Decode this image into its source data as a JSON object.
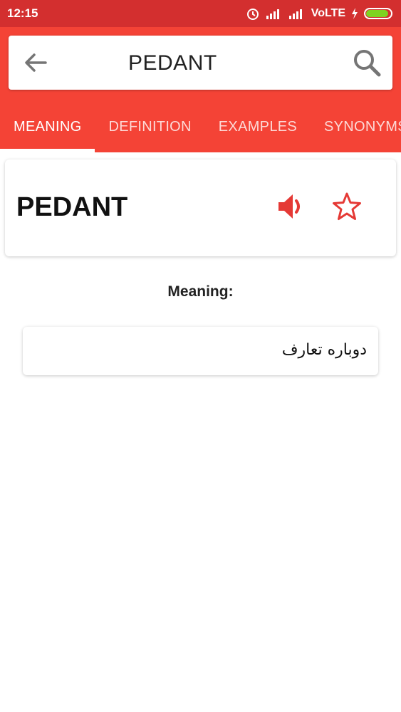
{
  "status_bar": {
    "time": "12:15",
    "network": "VoLTE",
    "battery_level": 0.9
  },
  "search": {
    "query": "PEDANT"
  },
  "tabs": [
    {
      "label": "MEANING",
      "active": true
    },
    {
      "label": "DEFINITION",
      "active": false
    },
    {
      "label": "EXAMPLES",
      "active": false
    },
    {
      "label": "SYNONYMS",
      "active": false
    }
  ],
  "word_card": {
    "word": "PEDANT"
  },
  "meaning": {
    "heading": "Meaning:",
    "text": "دوباره تعارف"
  },
  "colors": {
    "status_bar": "#d32f2f",
    "app_bar": "#f44336",
    "accent": "#e53935"
  },
  "icons": {
    "back": "arrow-left-icon",
    "search": "magnifier-icon",
    "speaker": "speaker-icon",
    "favorite": "star-outline-icon"
  }
}
